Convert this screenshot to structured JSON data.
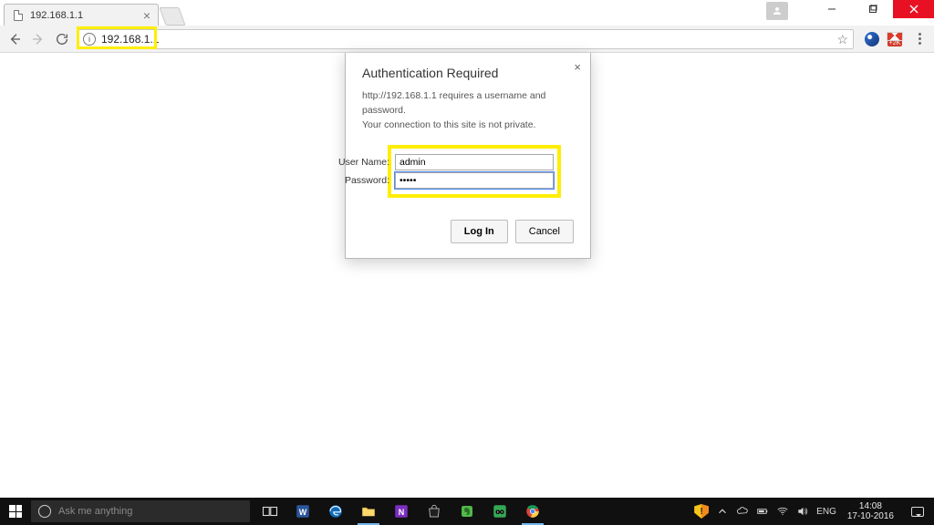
{
  "browser": {
    "tab_title": "192.168.1.1",
    "url": "192.168.1.1"
  },
  "extensions": {
    "gmail_badge": "+2K"
  },
  "dialog": {
    "title": "Authentication Required",
    "message_line1": "http://192.168.1.1 requires a username and password.",
    "message_line2": "Your connection to this site is not private.",
    "username_label": "User Name:",
    "password_label": "Password:",
    "username_value": "admin",
    "password_value": "•••••",
    "login_label": "Log In",
    "cancel_label": "Cancel"
  },
  "taskbar": {
    "search_placeholder": "Ask me anything",
    "lang": "ENG",
    "time": "14:08",
    "date": "17-10-2016"
  },
  "highlight_color": "#ffee00"
}
